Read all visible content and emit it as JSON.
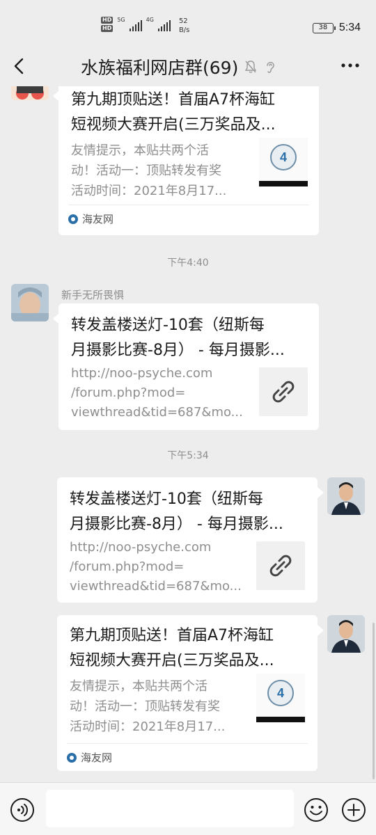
{
  "status_bar": {
    "hd_labels": [
      "HD",
      "HD"
    ],
    "net1": "5G",
    "net2": "4G",
    "speed_value": "52",
    "speed_unit": "B/s",
    "battery": "38",
    "time": "5:34"
  },
  "header": {
    "title": "水族福利网店群(69)"
  },
  "messages": [
    {
      "type": "link-card",
      "title": "第九期顶贴送！首届A7杯海缸短视频大赛开启(三万奖品及...",
      "title_line1": "第九期顶贴送！首届A7杯海缸",
      "title_line2": "短视频大赛开启(三万奖品及...",
      "desc_lines": [
        "友情提示，本贴共两个活",
        "动！活动一：顶贴转发有奖",
        "活动时间：2021年8月17..."
      ],
      "source": "海友网"
    },
    {
      "type": "time",
      "text": "下午4:40"
    },
    {
      "type": "link-card",
      "sender": "新手无所畏惧",
      "title_line1": "转发盖楼送灯-10套（纽斯每",
      "title_line2": "月摄影比赛-8月） - 每月摄影...",
      "desc_lines": [
        "http://noo-psyche.com",
        "/forum.php?mod=",
        "viewthread&tid=687&mo..."
      ]
    },
    {
      "type": "time",
      "text": "下午5:34"
    },
    {
      "type": "link-card",
      "title_line1": "转发盖楼送灯-10套（纽斯每",
      "title_line2": "月摄影比赛-8月） - 每月摄影...",
      "desc_lines": [
        "http://noo-psyche.com",
        "/forum.php?mod=",
        "viewthread&tid=687&mo..."
      ]
    },
    {
      "type": "link-card",
      "title_line1": "第九期顶贴送！首届A7杯海缸",
      "title_line2": "短视频大赛开启(三万奖品及...",
      "desc_lines": [
        "友情提示，本贴共两个活",
        "动！活动一：顶贴转发有奖",
        "活动时间：2021年8月17..."
      ],
      "source": "海友网"
    }
  ],
  "input": {
    "value": ""
  },
  "colors": {
    "background": "#ededed",
    "card": "#ffffff",
    "muted_text": "#8e8e8e"
  }
}
